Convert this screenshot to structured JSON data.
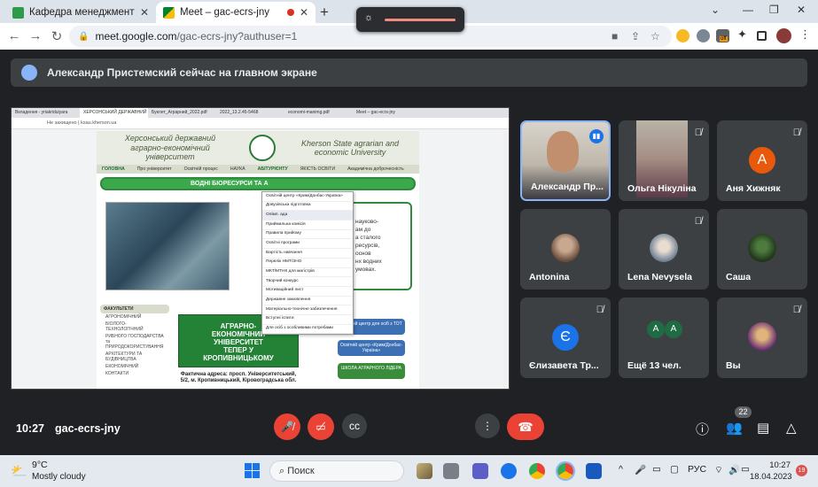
{
  "browser": {
    "tabs": [
      {
        "title": "Кафедра менеджменту та інфор",
        "close": "✕"
      },
      {
        "title": "Meet – gac-ecrs-jny",
        "close": "✕"
      }
    ],
    "new_tab": "+",
    "url_host": "meet.google.com",
    "url_path": "/gac-ecrs-jny?authuser=1",
    "extension_badge": "off"
  },
  "banner": {
    "text": "Александр Пристемский сейчас на главном экране"
  },
  "shared_screen": {
    "tabs": [
      "Вкладення - yriakriduiyara",
      "ХЕРСОНСЬКИЙ ДЕРЖАВНИЙ",
      "Буклет_Аграрний_2022.pdf",
      "2022_13.2.45-5468",
      "economi-manimg.pdf",
      "Meet – gac-ecrs-jny"
    ],
    "address": "Не захищено | ksau.kherson.ua",
    "header_left": "Херсонський державний аграрно-економічний університет",
    "header_right": "Kherson State agrarian and economic University",
    "nav": [
      "ГОЛОВНА",
      "Про університет",
      "Освітній процес",
      "НАУКА",
      "АБІТУРІЄНТУ",
      "ЯКІСТЬ ОСВІТИ",
      "Академічна доброчесність"
    ],
    "band": "ВОДНІ БІОРЕСУРСИ ТА А",
    "menu": [
      "Освітній центр «Крим/Донбас-Україна»",
      "Довузівська підготовка",
      "Олімп. ада",
      "Приймальна комісія",
      "Правила прийому",
      "Освітні програми",
      "Вартість навчання",
      "Перелік НМТ/ЗНО",
      "МКТ/МТНК для магістрів",
      "Творчий конкурс",
      "Мотиваційний лист",
      "Державне замовлення",
      "Матеріально-технічне забезпечення",
      "Вступні іспити",
      "Для осіб з особливими потребами"
    ],
    "right_text": [
      "науково-",
      "ам до",
      "а сталого",
      "ресурсів,",
      "основ",
      "нх водних",
      "умовах."
    ],
    "sidebar_title": "ФАКУЛЬТЕТИ",
    "sidebar_items": [
      "АГРОНОМІЧНИЙ",
      "БІОЛОГО-ТЕХНОЛОГІЧНИЙ",
      "РИБНОГО ГОСПОДАРСТВА та ПРИРОДОКОРИСТУВАННЯ",
      "АРХІТЕКТУРИ ТА БУДІВНИЦТВА",
      "ЕКОНОМІЧНИЙ",
      "КОНТАКТИ"
    ],
    "promo": "АГРАРНО-ЕКОНОМІЧНИЙ УНІВЕРСИТЕТ ТЕПЕР У КРОПИВНИЦЬКОМУ",
    "promo_address": "Фактична адреса: просп. Університетський, 5/2, м. Кропивницький, Кіровоградська обл.",
    "buttons": [
      "Освітній центр для осіб з ТОТ",
      "Освітній центр «Крим/Донбас-Україна»",
      "ШКОЛА АГРАРНОГО ЛІДЕРА"
    ]
  },
  "participants": [
    {
      "name": "Александр Пр...",
      "kind": "video"
    },
    {
      "name": "Ольга Нікуліна",
      "kind": "video"
    },
    {
      "name": "Аня Хижняк",
      "kind": "letter",
      "letter": "A",
      "color": "#e8590c"
    },
    {
      "name": "Antonina",
      "kind": "photo"
    },
    {
      "name": "Lena Nevysela",
      "kind": "photo"
    },
    {
      "name": "Саша",
      "kind": "photo"
    },
    {
      "name": "Єлизавета Тр...",
      "kind": "letter",
      "letter": "Є",
      "color": "#1a73e8"
    },
    {
      "name": "Ещё 13 чел.",
      "kind": "more",
      "letters": [
        "A",
        "A"
      ]
    },
    {
      "name": "Вы",
      "kind": "photo"
    }
  ],
  "meeting": {
    "time": "10:27",
    "code": "gac-ecrs-jny",
    "participant_count": "22"
  },
  "taskbar": {
    "temp": "9°C",
    "weather": "Mostly cloudy",
    "search": "Поиск",
    "lang": "РУС",
    "clock_time": "10:27",
    "clock_date": "18.04.2023",
    "notif_count": "19"
  },
  "colors": {
    "bg": "#202124",
    "tile": "#3c4043",
    "accent": "#8ab4f8",
    "danger": "#ea4335"
  }
}
